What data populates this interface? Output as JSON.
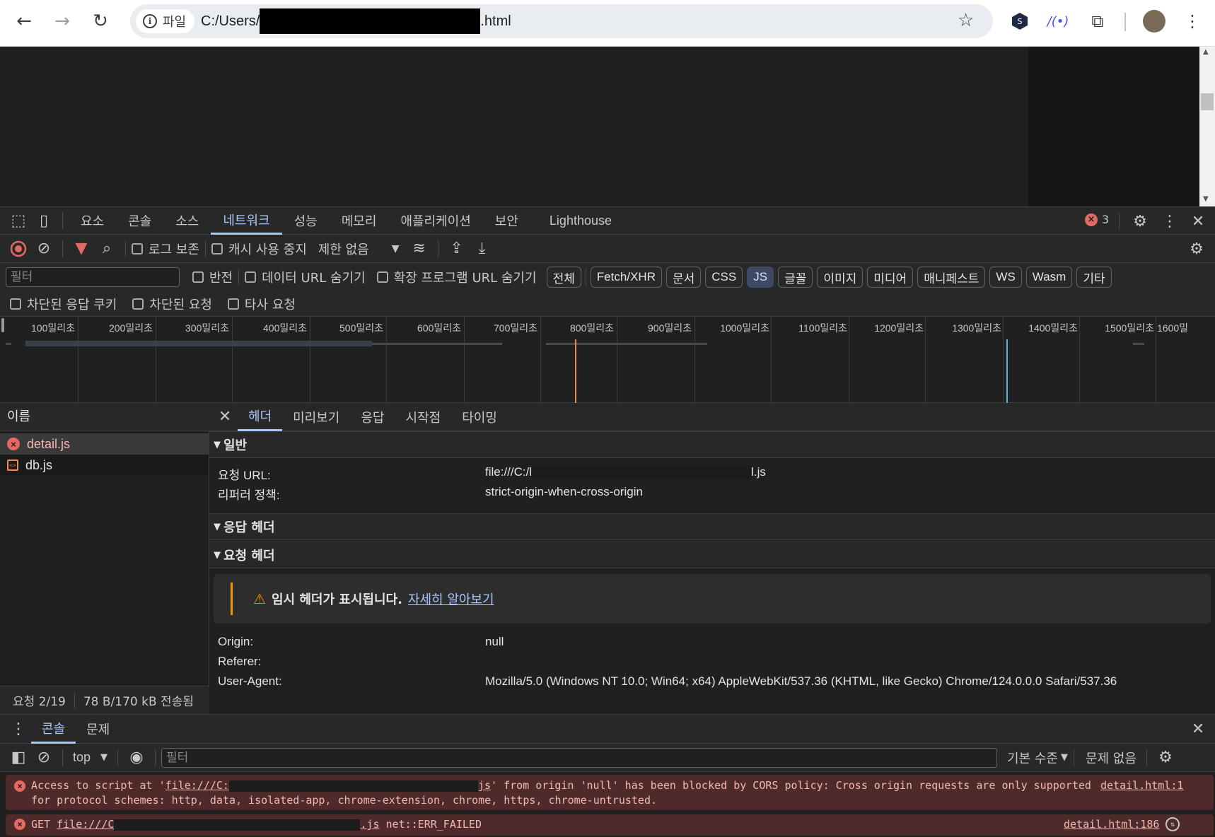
{
  "browser": {
    "site_chip": "파일",
    "url_prefix": "C:/Users/",
    "url_suffix": ".html"
  },
  "devtools": {
    "tabs": [
      "요소",
      "콘솔",
      "소스",
      "네트워크",
      "성능",
      "메모리",
      "애플리케이션",
      "보안",
      "Lighthouse"
    ],
    "active_tab": "네트워크",
    "error_count": "3"
  },
  "network_toolbar": {
    "preserve_log": "로그 보존",
    "disable_cache": "캐시 사용 중지",
    "throttle": "제한 없음"
  },
  "filter_bar": {
    "placeholder": "필터",
    "invert": "반전",
    "hide_data_urls": "데이터 URL 숨기기",
    "hide_ext_urls": "확장 프로그램 URL 숨기기",
    "types": [
      "전체",
      "Fetch/XHR",
      "문서",
      "CSS",
      "JS",
      "글꼴",
      "이미지",
      "미디어",
      "매니페스트",
      "WS",
      "Wasm",
      "기타"
    ],
    "selected_type": "JS"
  },
  "filter_bar2": {
    "blocked_cookies": "차단된 응답 쿠키",
    "blocked_requests": "차단된 요청",
    "third_party": "타사 요청"
  },
  "timeline": {
    "ticks": [
      "100밀리초",
      "200밀리초",
      "300밀리초",
      "400밀리초",
      "500밀리초",
      "600밀리초",
      "700밀리초",
      "800밀리초",
      "900밀리초",
      "1000밀리초",
      "1100밀리초",
      "1200밀리초",
      "1300밀리초",
      "1400밀리초",
      "1500밀리초",
      "1600밀"
    ]
  },
  "requests": {
    "header": "이름",
    "items": [
      {
        "name": "detail.js",
        "status": "error"
      },
      {
        "name": "db.js",
        "status": "script"
      }
    ],
    "status_count": "요청 2/19",
    "status_transfer": "78 B/170 kB 전송됨"
  },
  "detail": {
    "tabs": [
      "헤더",
      "미리보기",
      "응답",
      "시작점",
      "타이밍"
    ],
    "active_tab": "헤더",
    "general": {
      "title": "일반",
      "request_url_key": "요청 URL:",
      "request_url_val_a": "file:///C:/l",
      "request_url_val_b": "l.js",
      "referrer_key": "리퍼러 정책:",
      "referrer_val": "strict-origin-when-cross-origin"
    },
    "response_headers_title": "응답 헤더",
    "request_headers": {
      "title": "요청 헤더",
      "warning_bold": "임시 헤더가 표시됩니다.",
      "warning_link": "자세히 알아보기",
      "origin_key": "Origin:",
      "origin_val": "null",
      "referer_key": "Referer:",
      "ua_key": "User-Agent:",
      "ua_val": "Mozilla/5.0 (Windows NT 10.0; Win64; x64) AppleWebKit/537.36 (KHTML, like Gecko) Chrome/124.0.0.0 Safari/537.36"
    }
  },
  "drawer": {
    "tabs": [
      "콘솔",
      "문제"
    ],
    "active_tab": "콘솔",
    "context": "top",
    "filter_placeholder": "필터",
    "levels": "기본 수준",
    "issues": "문제 없음"
  },
  "console": {
    "msg1_a": "Access to script at '",
    "msg1_link": "file:///C:",
    "msg1_link_end": "js",
    "msg1_b": "' from origin 'null' has been blocked by CORS policy: Cross origin requests are only supported",
    "msg1_c": "for protocol schemes: http, data, isolated-app, chrome-extension, chrome, https, chrome-untrusted.",
    "msg1_src": "detail.html:1",
    "msg2_a": "GET ",
    "msg2_link": "file:///C",
    "msg2_link_end": ".js",
    "msg2_b": " net::ERR_FAILED",
    "msg2_src": "detail.html:186"
  }
}
